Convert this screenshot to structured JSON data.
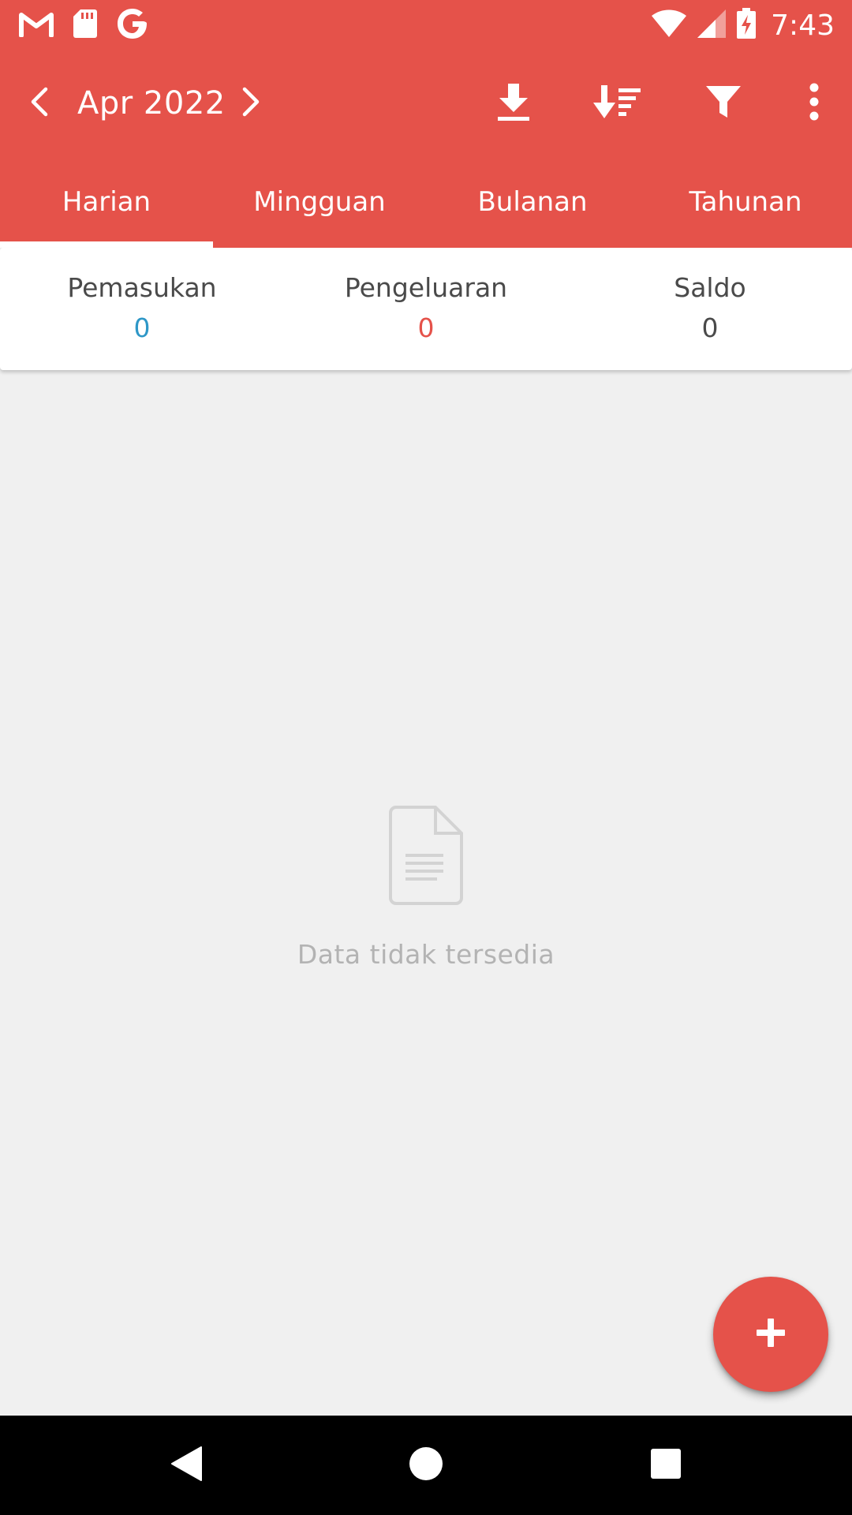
{
  "status_bar": {
    "time": "7:43",
    "left_icons": [
      "gmail-icon",
      "sd-card-icon",
      "google-icon"
    ],
    "right_icons": [
      "wifi-icon",
      "cell-signal-icon",
      "battery-charging-icon"
    ]
  },
  "toolbar": {
    "prev_icon": "chevron-left-icon",
    "month_label": "Apr 2022",
    "next_icon": "chevron-right-icon",
    "actions": [
      "download-icon",
      "sort-icon",
      "filter-icon",
      "more-vert-icon"
    ]
  },
  "tabs": [
    {
      "label": "Harian",
      "active": true
    },
    {
      "label": "Mingguan",
      "active": false
    },
    {
      "label": "Bulanan",
      "active": false
    },
    {
      "label": "Tahunan",
      "active": false
    }
  ],
  "summary": {
    "income": {
      "label": "Pemasukan",
      "value": "0",
      "color": "#2e97c7"
    },
    "expense": {
      "label": "Pengeluaran",
      "value": "0",
      "color": "#e5524a"
    },
    "balance": {
      "label": "Saldo",
      "value": "0",
      "color": "#4a4a4a"
    }
  },
  "empty_state": {
    "icon": "document-icon",
    "text": "Data tidak tersedia"
  },
  "fab": {
    "icon": "plus-icon"
  },
  "navbar": {
    "icons": [
      "back-icon",
      "home-icon",
      "recents-icon"
    ]
  },
  "colors": {
    "primary": "#e5524a",
    "background": "#f0f0f0",
    "income": "#2e97c7",
    "expense": "#e5524a"
  }
}
